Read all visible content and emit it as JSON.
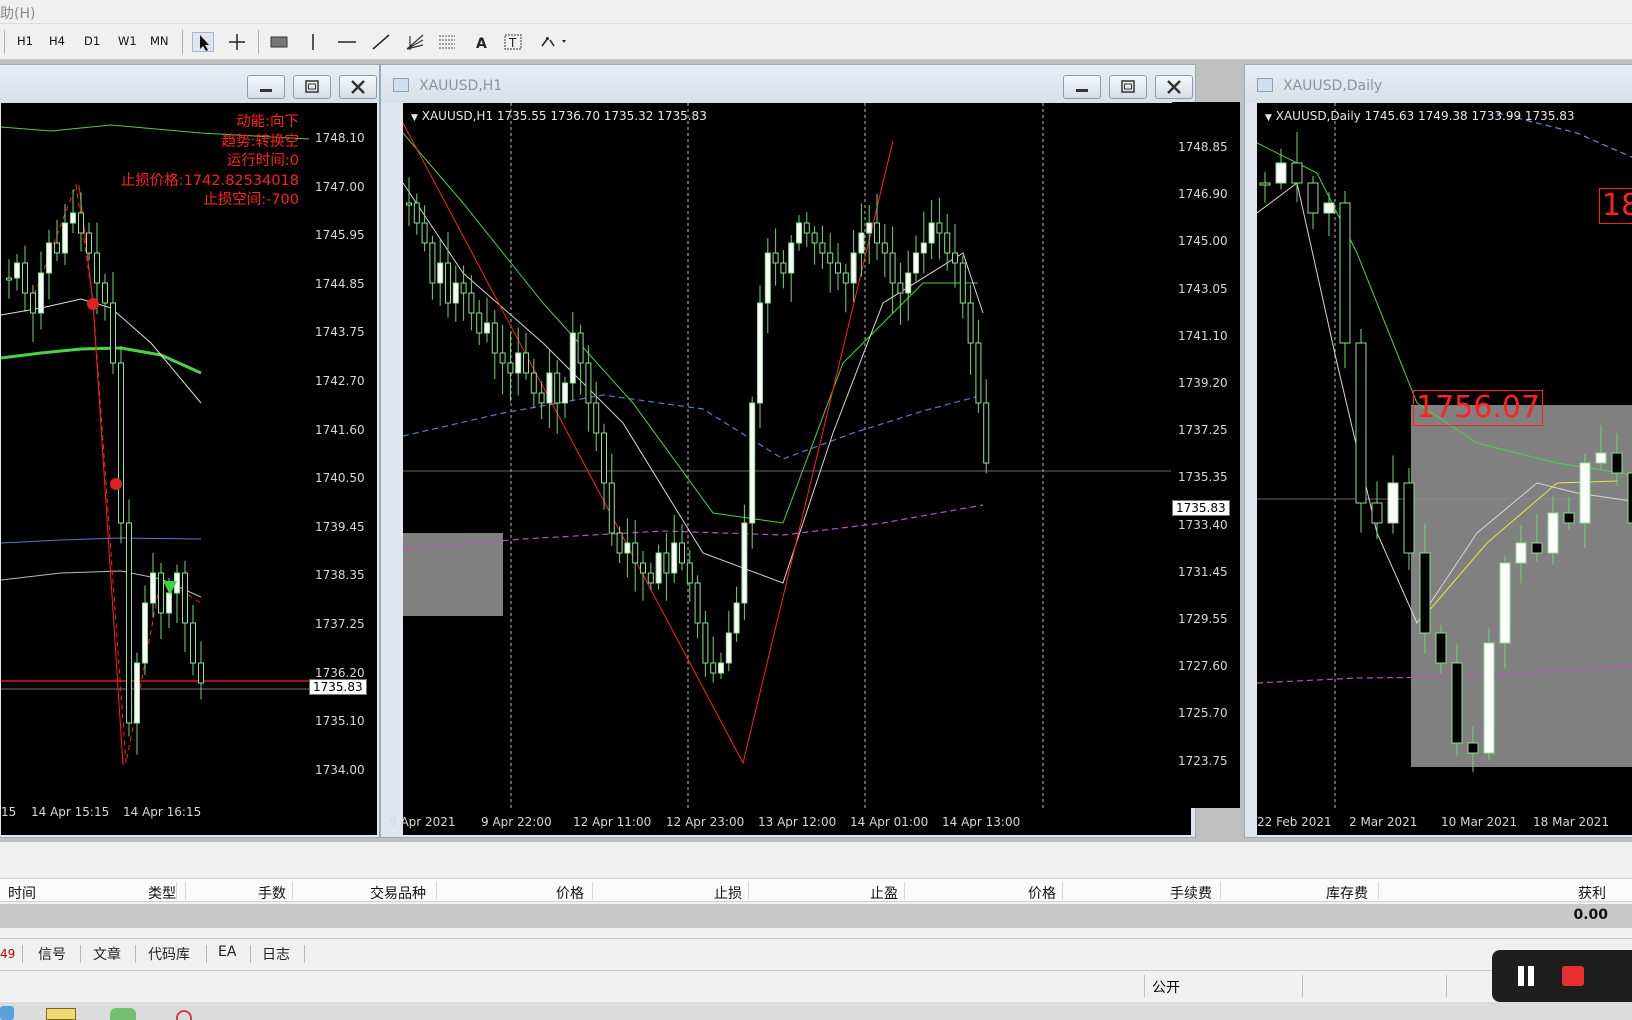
{
  "menu": {
    "partial_label": "助(H)"
  },
  "toolbar": {
    "timeframes": [
      "H1",
      "H4",
      "D1",
      "W1",
      "MN"
    ]
  },
  "left_chart": {
    "y_ticks": [
      "1748.10",
      "1747.00",
      "1745.95",
      "1744.85",
      "1743.75",
      "1742.70",
      "1741.60",
      "1740.50",
      "1739.45",
      "1738.35",
      "1737.25",
      "1736.20",
      "1735.10",
      "1734.00"
    ],
    "price_tag": "1735.83",
    "x_ticks": [
      "15",
      "14 Apr 15:15",
      "14 Apr 16:15"
    ],
    "info_lines": [
      "动能:向下",
      "趋势:转换空",
      "运行时间:0",
      "止损价格:1742.82534018",
      "止损空间:-700"
    ]
  },
  "mid_chart": {
    "window_title": "XAUUSD,H1",
    "ohlc": "XAUUSD,H1  1735.55 1736.70 1735.32 1735.83",
    "y_ticks": [
      "1748.85",
      "1746.90",
      "1745.00",
      "1743.05",
      "1741.10",
      "1739.20",
      "1737.25",
      "1735.35",
      "1733.40",
      "1731.45",
      "1729.55",
      "1727.60",
      "1725.70",
      "1723.75"
    ],
    "price_tag": "1735.83",
    "x_ticks": [
      "9 Apr 2021",
      "9 Apr 22:00",
      "12 Apr 11:00",
      "12 Apr 23:00",
      "13 Apr 12:00",
      "14 Apr 01:00",
      "14 Apr 13:00"
    ]
  },
  "right_chart": {
    "window_title": "XAUUSD,Daily",
    "ohlc": "XAUUSD,Daily  1745.63 1749.38 1733.99 1735.83",
    "price_label": "1756.07",
    "partial_label": "18",
    "x_ticks": [
      "22 Feb 2021",
      "2 Mar 2021",
      "10 Mar 2021",
      "18 Mar 2021"
    ]
  },
  "terminal": {
    "columns": [
      "时间",
      "类型",
      "手数",
      "交易品种",
      "价格",
      "止损",
      "止盈",
      "价格",
      "手续费",
      "库存费",
      "获利"
    ],
    "total_profit": "0.00",
    "tabs": [
      "49",
      "信号",
      "文章",
      "代码库",
      "EA",
      "日志"
    ]
  },
  "status": {
    "mode": "公开"
  },
  "colors": {
    "chart_bg": "#000000",
    "bull_candle": "#ffffff",
    "wick": "#90ee90",
    "ma_green": "#4cd04c",
    "ma_blue": "#5a7ac8",
    "ma_magenta": "#c050c0",
    "zone": "#808080",
    "alert_red": "#ff2020"
  }
}
